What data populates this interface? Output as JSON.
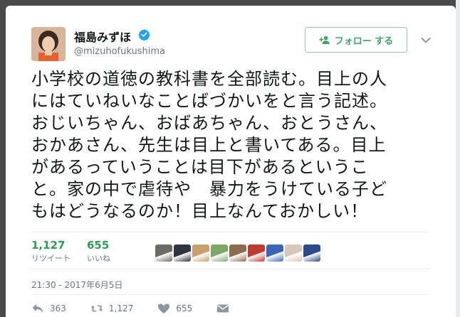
{
  "author": {
    "name": "福島みずほ",
    "handle": "@mizuhofukushima",
    "verified": true
  },
  "follow_button": {
    "label": "フォロー する"
  },
  "tweet": {
    "lines": [
      "小学校の道徳の教科書を全部読む。目上の人",
      "にはていねいなことばづかいをと言う記述。",
      "おじいちゃん、おばあちゃん、おとうさん、",
      "おかあさん、先生は目上と書いてある。目上",
      "があるっていうことは目下があるというこ",
      "と。家の中で虐待や　暴力をうけている子ど",
      "もはどうなるのか！目上なんておかしい！"
    ]
  },
  "stats": {
    "retweets": {
      "count": "1,127",
      "label": "リツイート"
    },
    "likes": {
      "count": "655",
      "label": "いいね"
    }
  },
  "liker_avatars": [
    {
      "icon": "cat-face-icon",
      "color": "#6e6a66"
    },
    {
      "icon": "anime-girl-icon",
      "color": "#2f3440"
    },
    {
      "icon": "cat-orange-icon",
      "color": "#c9a06a"
    },
    {
      "icon": "green-character-icon",
      "color": "#7ea86a"
    },
    {
      "icon": "cat-brown-icon",
      "color": "#8c6b4e"
    },
    {
      "icon": "red-character-icon",
      "color": "#c23b2e"
    },
    {
      "icon": "blue-yellow-icon",
      "color": "#3a66b8"
    },
    {
      "icon": "light-photo-icon",
      "color": "#d8c8b8"
    },
    {
      "icon": "blue-anime-icon",
      "color": "#2c4a8c"
    }
  ],
  "timestamp": "21:30 - 2017年6月5日",
  "actions": {
    "reply": {
      "icon": "reply-icon",
      "count": "363"
    },
    "retweet": {
      "icon": "retweet-icon",
      "count": "1,127"
    },
    "like": {
      "icon": "heart-icon",
      "count": "655"
    },
    "dm": {
      "icon": "envelope-icon"
    }
  },
  "colors": {
    "accent_green": "#2a9d56",
    "verified_blue": "#1da1f2",
    "muted": "#657786"
  }
}
